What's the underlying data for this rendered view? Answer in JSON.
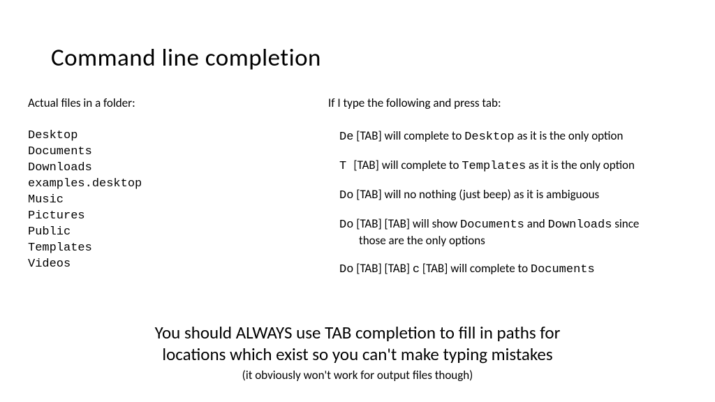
{
  "title": "Command line completion",
  "left": {
    "heading": "Actual files in a folder:",
    "files": [
      "Desktop",
      "Documents",
      "Downloads",
      "examples.desktop",
      "Music",
      "Pictures",
      "Public",
      "Templates",
      "Videos"
    ]
  },
  "right": {
    "heading": "If I type the following and press tab:",
    "examples": [
      {
        "segments": [
          {
            "text": "De",
            "mono": true
          },
          {
            "text": " [TAB] will complete to "
          },
          {
            "text": "Desktop",
            "mono": true
          },
          {
            "text": " as it is the only option"
          }
        ]
      },
      {
        "segments": [
          {
            "text": "T ",
            "mono": true
          },
          {
            "text": " [TAB] will complete to "
          },
          {
            "text": "Templates",
            "mono": true
          },
          {
            "text": " as it is the only option"
          }
        ]
      },
      {
        "segments": [
          {
            "text": "Do",
            "mono": true
          },
          {
            "text": " [TAB] will no nothing (just beep) as it is ambiguous"
          }
        ]
      },
      {
        "segments": [
          {
            "text": "Do",
            "mono": true
          },
          {
            "text": " [TAB] [TAB] will show "
          },
          {
            "text": "Documents",
            "mono": true
          },
          {
            "text": " and "
          },
          {
            "text": "Downloads",
            "mono": true
          },
          {
            "text": " since"
          }
        ],
        "continuation": [
          {
            "text": "those are the only options"
          }
        ]
      },
      {
        "segments": [
          {
            "text": "Do",
            "mono": true
          },
          {
            "text": " [TAB] [TAB] "
          },
          {
            "text": "c",
            "mono": true
          },
          {
            "text": " [TAB] will complete to "
          },
          {
            "text": "Documents",
            "mono": true
          }
        ]
      }
    ]
  },
  "footer": {
    "line1": "You should ALWAYS use TAB completion to fill in paths for",
    "line2": "locations which exist so you can't make typing mistakes",
    "sub": "(it obviously won't work for output files though)"
  }
}
